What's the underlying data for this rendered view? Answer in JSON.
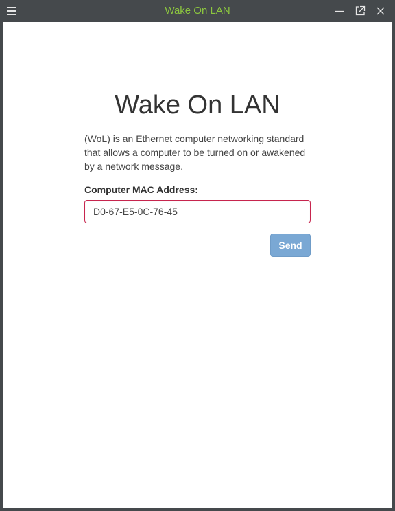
{
  "window": {
    "title": "Wake On LAN",
    "title_color": "#8cc63f",
    "chrome_color": "#45494c",
    "controls": [
      "hamburger-icon",
      "minimize-icon",
      "popout-icon",
      "close-icon"
    ]
  },
  "main": {
    "heading": "Wake On LAN",
    "description": "(WoL) is an Ethernet computer networking standard that allows a computer to be turned on or awakened by a network message.",
    "mac_label": "Computer MAC Address:",
    "mac_value": "D0-67-E5-0C-76-45",
    "send_label": "Send",
    "send_color": "#7aa8d4",
    "input_border_color": "#c7254e"
  }
}
